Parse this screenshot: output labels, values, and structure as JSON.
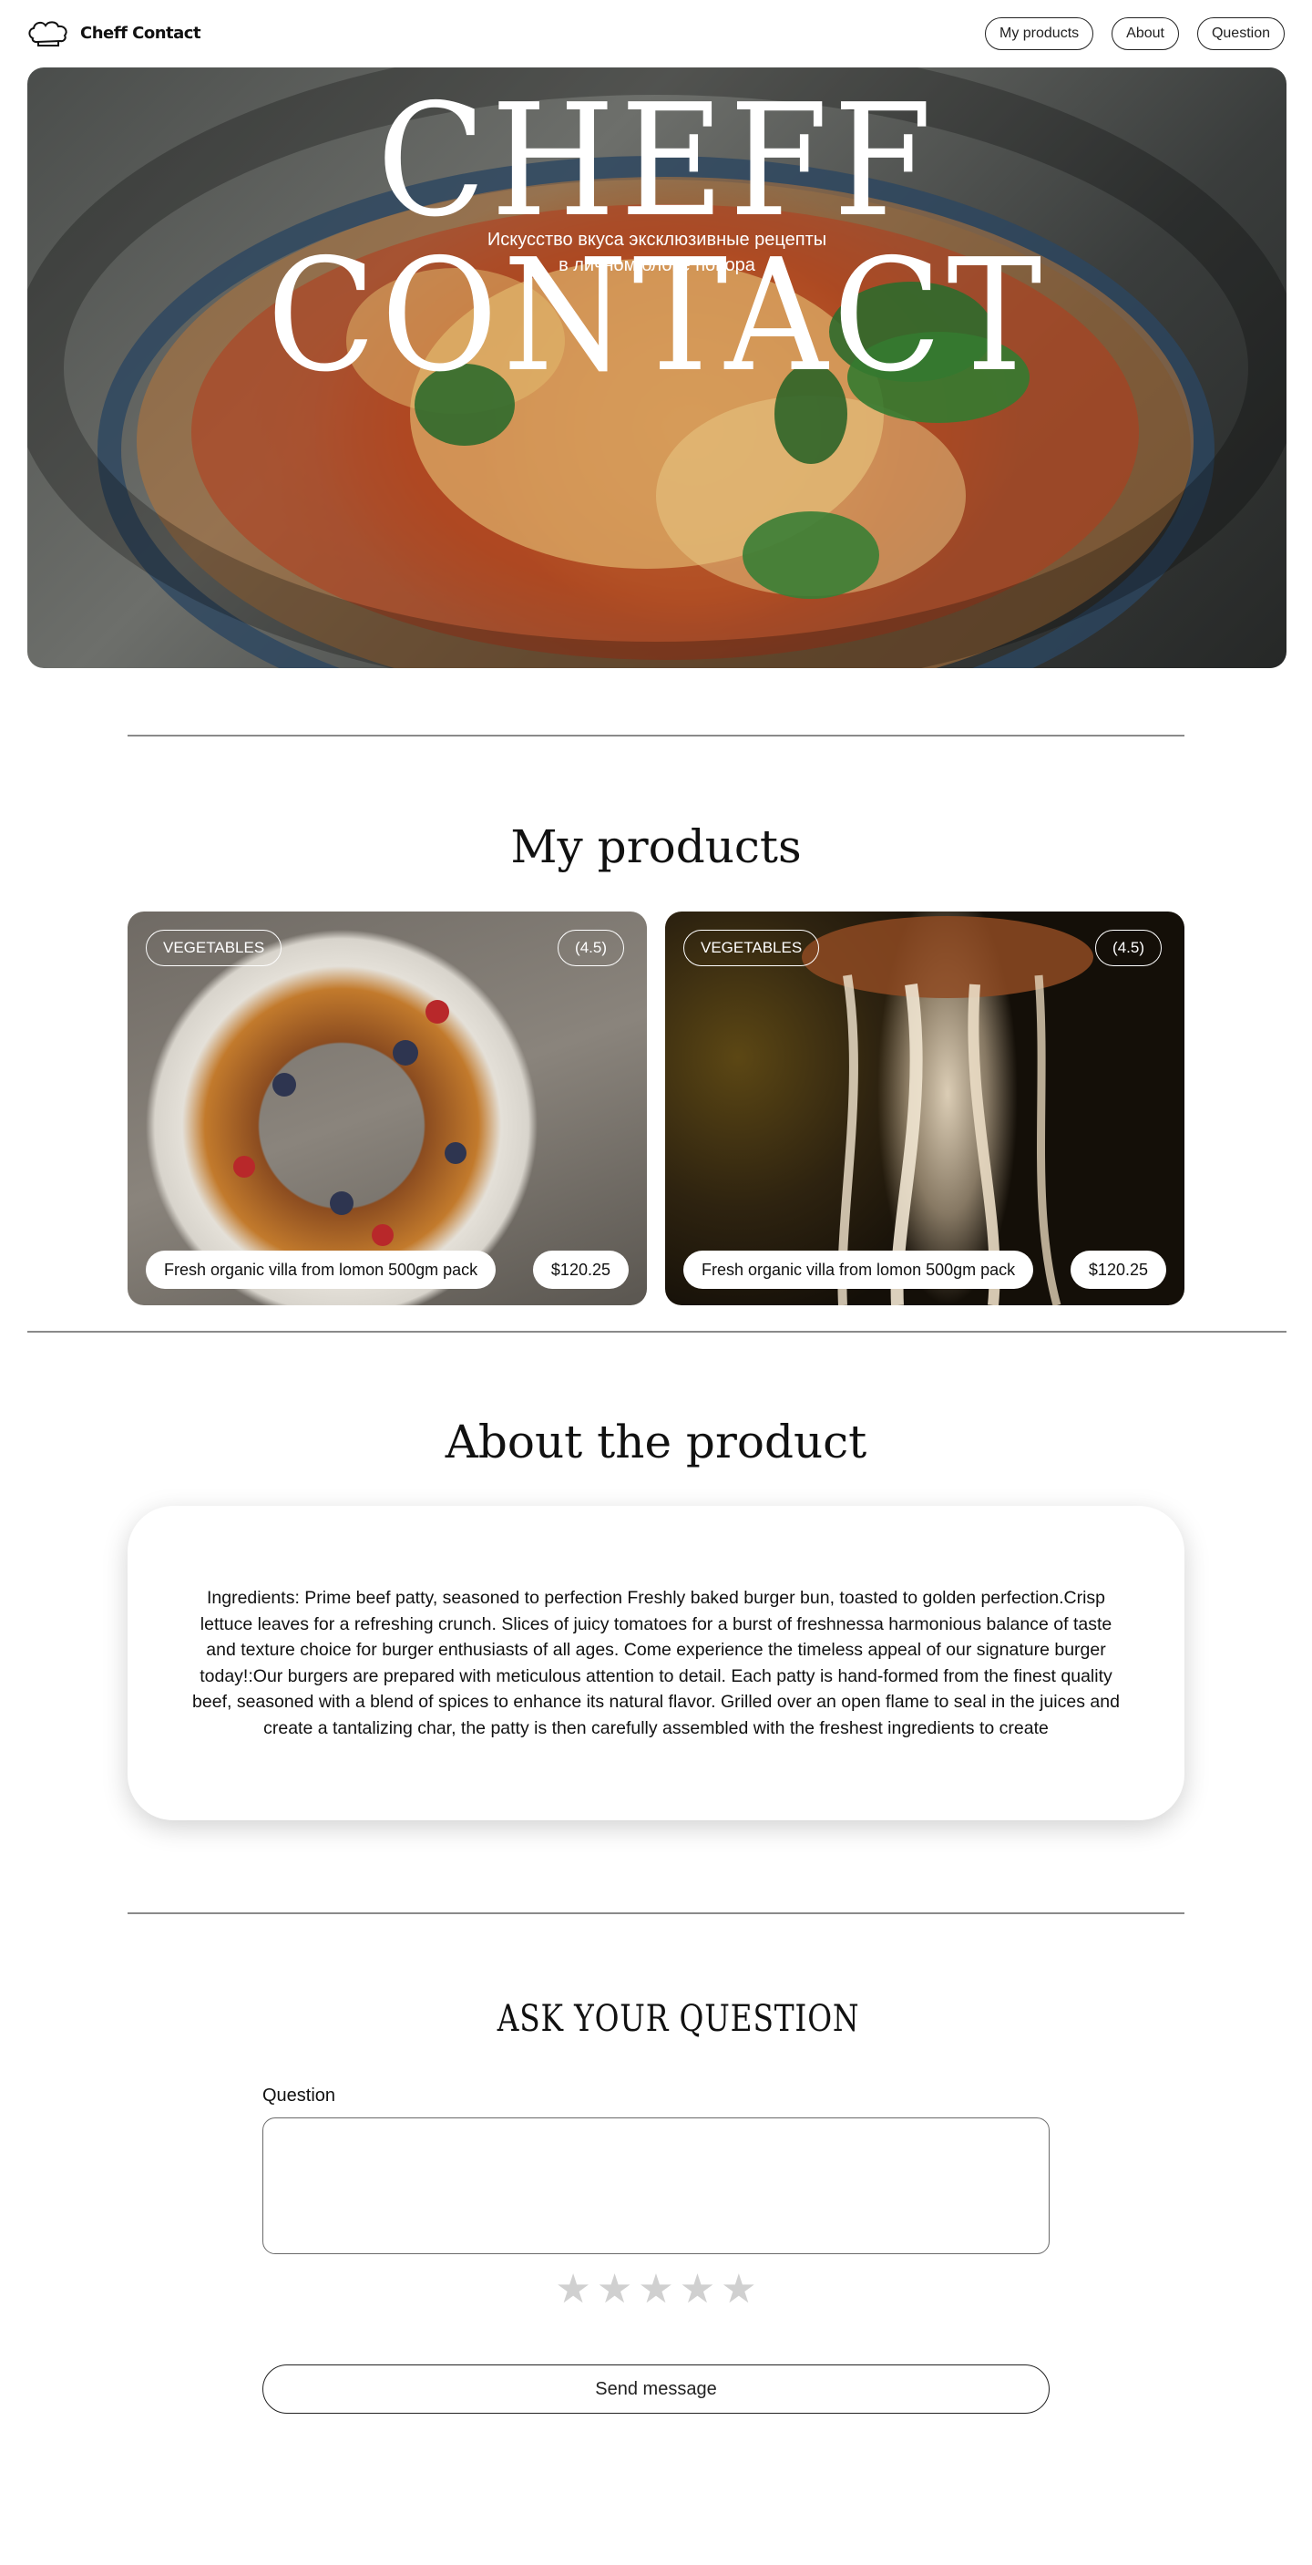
{
  "header": {
    "logo_text": "Cheff Contact",
    "nav": [
      {
        "label": "My products"
      },
      {
        "label": "About"
      },
      {
        "label": "Question"
      }
    ]
  },
  "hero": {
    "title": "CHEFF CONTACT",
    "subtitle_line1": "Искусство вкуса эксклюзивные рецепты",
    "subtitle_line2": "в личном блоке повора"
  },
  "products": {
    "title": "My products",
    "items": [
      {
        "tag": "VEGETABLES",
        "rating": "(4.5)",
        "name": "Fresh organic villa from lomon 500gm pack",
        "price": "$120.25"
      },
      {
        "tag": "VEGETABLES",
        "rating": "(4.5)",
        "name": "Fresh organic villa from lomon 500gm pack",
        "price": "$120.25"
      }
    ]
  },
  "about": {
    "title": "About the product",
    "text": "Ingredients: Prime beef patty, seasoned to perfection  Freshly baked burger bun, toasted to golden perfection.Crisp lettuce leaves for a refreshing crunch. Slices of juicy tomatoes for a burst of freshnessa harmonious balance of taste and texture choice for burger enthusiasts of all ages. Come experience the timeless appeal of our signature burger today!:Our burgers are prepared with meticulous attention to detail. Each patty is hand-formed from the finest quality beef, seasoned with a blend of spices to enhance its natural flavor. Grilled over an open flame to seal in the juices and create a tantalizing char, the patty is then carefully assembled with the freshest ingredients to create"
  },
  "question": {
    "title": "ASK YOUR QUESTION",
    "label": "Question",
    "value": "",
    "star_count": 5,
    "rating": 0,
    "send_label": "Send message"
  },
  "colors": {
    "text": "#111111",
    "border": "#222222",
    "divider": "#8a8a8a",
    "star_inactive": "#d0d0d0"
  }
}
